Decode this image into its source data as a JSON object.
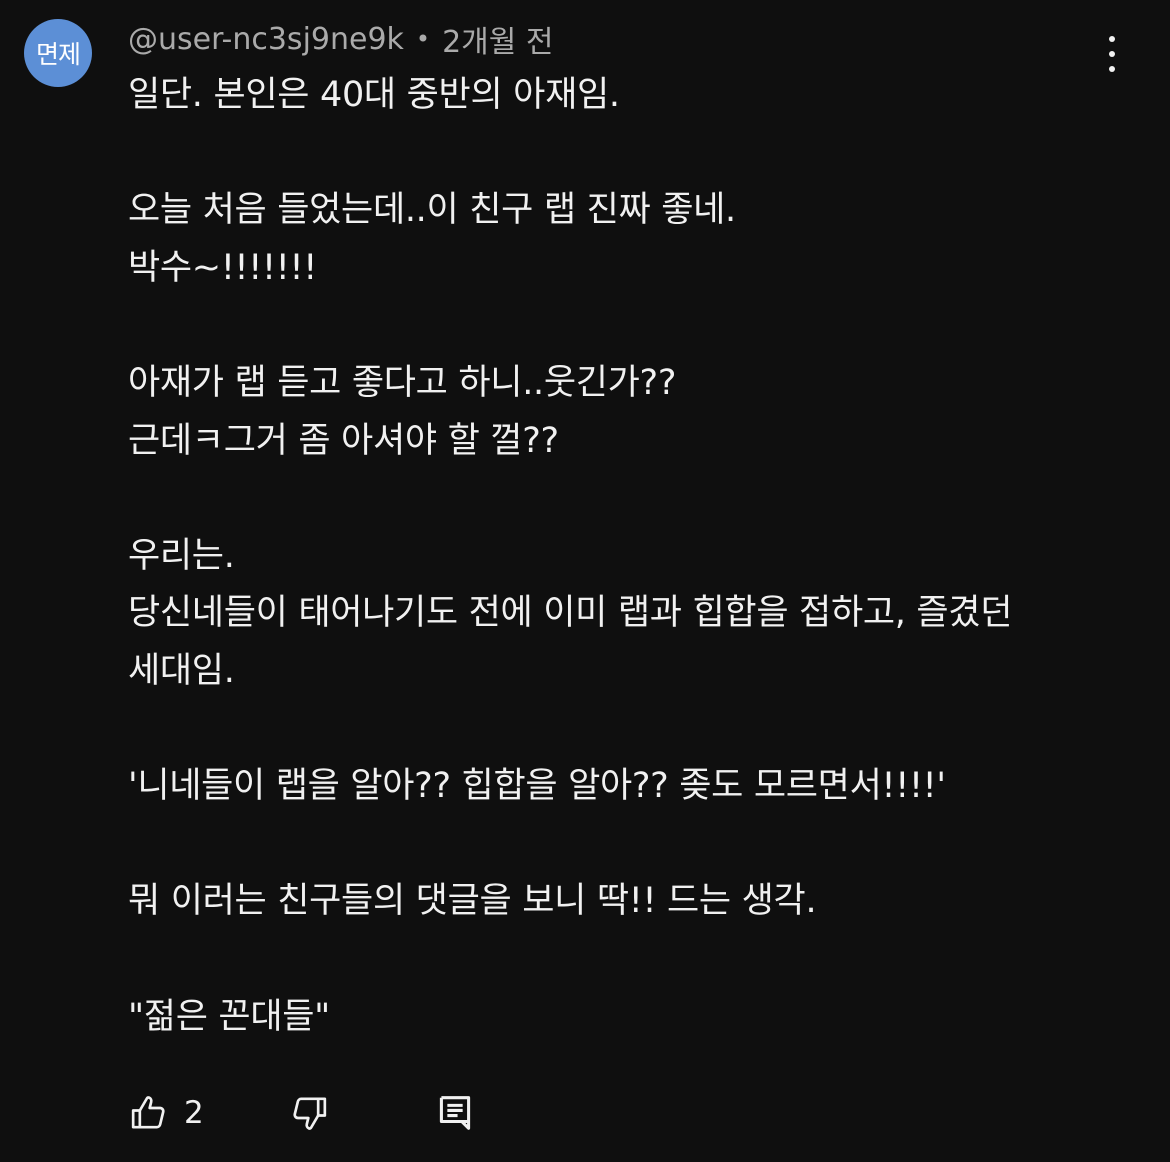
{
  "avatar": {
    "text": "면제",
    "color": "#5c8fd6"
  },
  "header": {
    "username": "@user-nc3sj9ne9k",
    "separator": "•",
    "timestamp": "2개월 전"
  },
  "menu": {
    "icon": "more-vertical-icon"
  },
  "comment_lines": [
    "일단. 본인은 40대 중반의 아재임.",
    "",
    "오늘 처음 들었는데..이 친구 랩 진짜 좋네.",
    "박수~!!!!!!!",
    "",
    "아재가 랩 듣고 좋다고 하니..웃긴가??",
    "근데ㅋ그거 좀 아셔야 할 껄??",
    "",
    "우리는.",
    "당신네들이 태어나기도 전에 이미 랩과 힙합을 접하고, 즐겼던",
    "세대임.",
    "",
    "'니네들이 랩을 알아?? 힙합을 알아?? 좆도 모르면서!!!!'",
    "",
    "뭐 이러는 친구들의 댓글을 보니 딱!! 드는 생각.",
    "",
    "\"젊은 꼰대들\""
  ],
  "actions": {
    "like_icon": "thumbs-up-icon",
    "like_count": "2",
    "dislike_icon": "thumbs-down-icon",
    "reply_icon": "reply-comment-icon"
  }
}
